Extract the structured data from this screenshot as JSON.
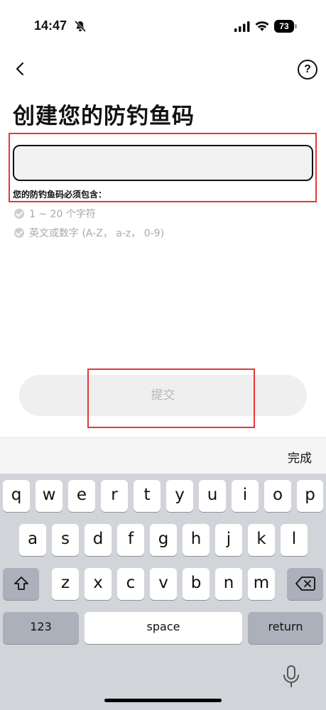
{
  "status_bar": {
    "time": "14:47",
    "battery": "73"
  },
  "nav": {
    "help_symbol": "?"
  },
  "page": {
    "title": "创建您的防钓鱼码",
    "input_value": "",
    "requirements_title": "您的防钓鱼码必须包含：",
    "requirements": [
      "1 ~ 20 个字符",
      "英文或数字 (A-Z， a-z， 0-9)"
    ],
    "submit_label": "提交"
  },
  "keyboard": {
    "done_label": "完成",
    "row1": [
      "q",
      "w",
      "e",
      "r",
      "t",
      "y",
      "u",
      "i",
      "o",
      "p"
    ],
    "row2": [
      "a",
      "s",
      "d",
      "f",
      "g",
      "h",
      "j",
      "k",
      "l"
    ],
    "row3": [
      "z",
      "x",
      "c",
      "v",
      "b",
      "n",
      "m"
    ],
    "numbers_label": "123",
    "space_label": "space",
    "return_label": "return"
  },
  "colors": {
    "highlight": "#e53935",
    "keyboard_bg": "#d1d4d9",
    "submit_bg": "#efefef"
  }
}
